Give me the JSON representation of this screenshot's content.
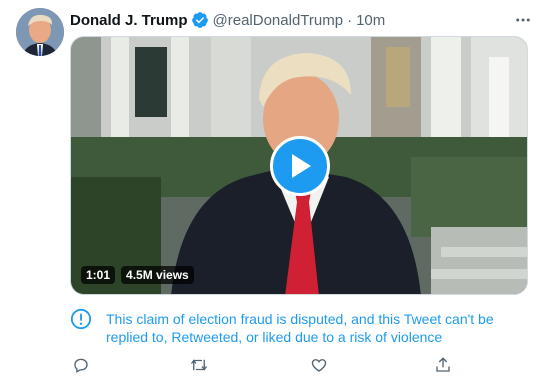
{
  "tweet": {
    "author_name": "Donald J. Trump",
    "handle": "@realDonaldTrump",
    "separator": "·",
    "timestamp": "10m",
    "more_icon": "more-horizontal-icon",
    "verified_icon": "verified-badge-icon"
  },
  "video": {
    "duration": "1:01",
    "views": "4.5M views",
    "play_icon": "play-icon"
  },
  "notice": {
    "icon": "exclamation-circle-icon",
    "text": "This claim of election fraud is disputed, and this Tweet can't be replied to, Retweeted, or liked due to a risk of violence"
  },
  "actions": {
    "reply_icon": "reply-icon",
    "retweet_icon": "retweet-icon",
    "like_icon": "like-icon",
    "share_icon": "share-icon"
  },
  "colors": {
    "accent": "#1d9bf0",
    "muted": "#536471",
    "text": "#0f1419",
    "border": "#cfd9de"
  }
}
